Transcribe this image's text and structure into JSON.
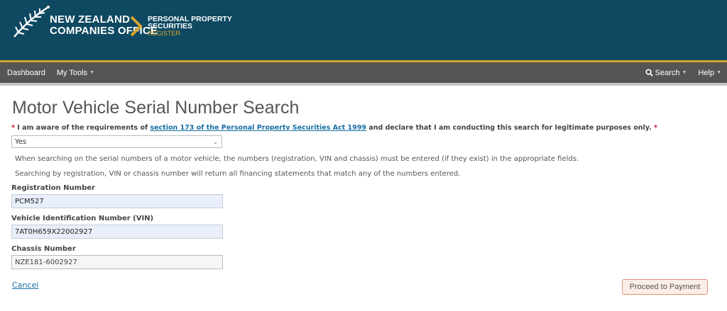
{
  "header": {
    "logo_line1": "NEW ZEALAND",
    "logo_line2": "COMPANIES OFFICE",
    "ppsr_line1": "PERSONAL PROPERTY",
    "ppsr_line2": "SECURITIES",
    "ppsr_line3": "REGISTER"
  },
  "nav": {
    "dashboard": "Dashboard",
    "my_tools": "My Tools",
    "search": "Search",
    "help": "Help"
  },
  "page": {
    "title": "Motor Vehicle Serial Number Search",
    "declaration_prefix": "I am aware of the requirements of",
    "declaration_link": "section 173 of the Personal Property Securities Act 1999",
    "declaration_suffix": "and declare that I am conducting this search for legitimate purposes only.",
    "required_marker": "*",
    "declaration_value": "Yes",
    "info1": "When searching on the serial numbers of a motor vehicle, the numbers (registration, VIN and chassis) must be entered (if they exist) in the appropriate fields.",
    "info2": "Searching by registration, VIN or chassis number will return all financing statements that match any of the numbers entered."
  },
  "form": {
    "registration_label": "Registration Number",
    "registration_value": "PCM527",
    "vin_label": "Vehicle Identification Number (VIN)",
    "vin_value": "7AT0H659X22002927",
    "chassis_label": "Chassis Number",
    "chassis_value": "NZE181-6002927"
  },
  "actions": {
    "cancel": "Cancel",
    "proceed": "Proceed to Payment"
  }
}
